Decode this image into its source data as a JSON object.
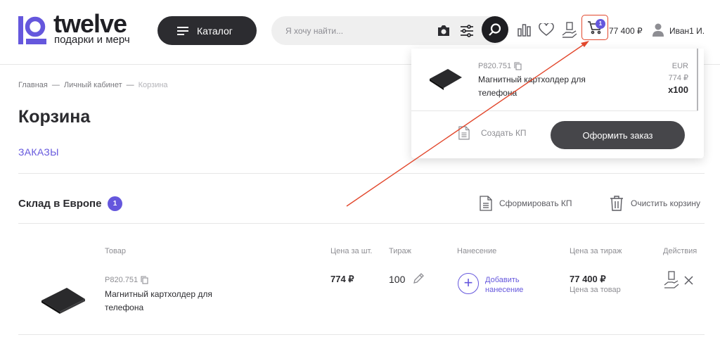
{
  "header": {
    "logo_name": "twelve",
    "logo_tagline": "подарки и мерч",
    "catalog_label": "Каталог",
    "search_placeholder": "Я хочу найти...",
    "cart_count": "1",
    "cart_total": "77 400 ₽",
    "user_name": "Иван1 И."
  },
  "breadcrumb": {
    "items": [
      "Главная",
      "—",
      "Личный кабинет",
      "—",
      "Корзина"
    ]
  },
  "page": {
    "title": "Корзина",
    "orders_link": "ЗАКАЗЫ"
  },
  "warehouse": {
    "title": "Склад в Европе",
    "count": "1",
    "make_quote": "Сформировать КП",
    "clear_cart": "Очистить корзину"
  },
  "table": {
    "headers": [
      "Товар",
      "Цена за шт.",
      "Тираж",
      "Нанесение",
      "Цена за тираж",
      "Действия"
    ],
    "rows": [
      {
        "sku": "P820.751",
        "name": "Магнитный картхолдер для телефона",
        "unit_price": "774 ₽",
        "quantity": "100",
        "add_print": "Добавить нанесение",
        "total": "77 400 ₽",
        "total_note": "Цена за товар"
      }
    ]
  },
  "cart_dropdown": {
    "sku": "P820.751",
    "name": "Магнитный картхолдер для телефона",
    "currency": "EUR",
    "price": "774 ₽",
    "qty": "x100",
    "create_quote": "Создать КП",
    "checkout": "Оформить заказ"
  },
  "colors": {
    "accent": "#6557dd",
    "dark": "#2c2c30",
    "highlight": "#e2472c"
  }
}
